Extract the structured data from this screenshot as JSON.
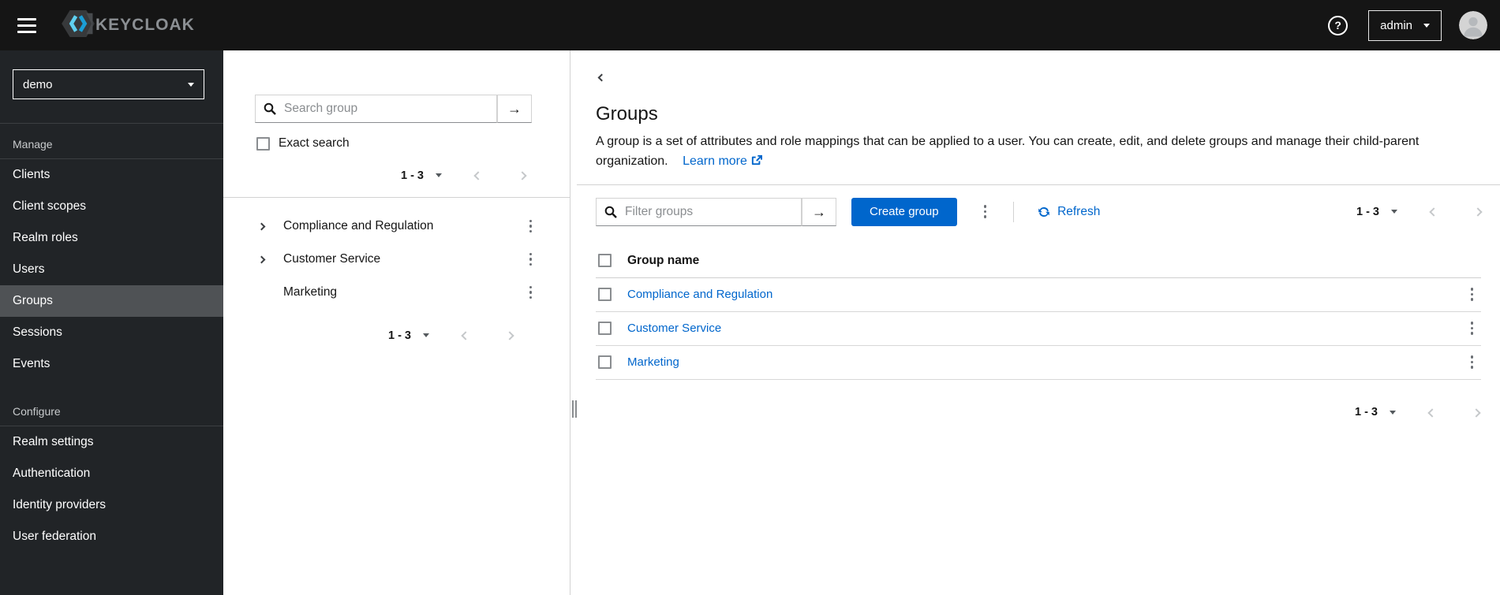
{
  "header": {
    "brand": "KEYCLOAK",
    "user": "admin",
    "help": "?"
  },
  "sidebar": {
    "realm": "demo",
    "sections": [
      {
        "label": "Manage",
        "items": [
          "Clients",
          "Client scopes",
          "Realm roles",
          "Users",
          "Groups",
          "Sessions",
          "Events"
        ],
        "selected_item": "Groups"
      },
      {
        "label": "Configure",
        "items": [
          "Realm settings",
          "Authentication",
          "Identity providers",
          "User federation"
        ]
      }
    ]
  },
  "tree_panel": {
    "search_placeholder": "Search group",
    "search_submit": "→",
    "exact_search_label": "Exact search",
    "top_pagination": {
      "range": "1 - 3"
    },
    "groups": [
      {
        "name": "Compliance and Regulation",
        "expandable": true
      },
      {
        "name": "Customer Service",
        "expandable": true
      },
      {
        "name": "Marketing",
        "expandable": false
      }
    ],
    "bottom_pagination": {
      "range": "1 - 3"
    }
  },
  "main": {
    "title": "Groups",
    "description": "A group is a set of attributes and role mappings that can be applied to a user. You can create, edit, and delete groups and manage their child-parent organization.",
    "learn_more_label": "Learn more",
    "toolbar": {
      "filter_placeholder": "Filter groups",
      "filter_submit": "→",
      "create_button_label": "Create group",
      "refresh_label": "Refresh",
      "pagination": {
        "range": "1 - 3"
      }
    },
    "table": {
      "columns": [
        "Group name"
      ],
      "rows": [
        "Compliance and Regulation",
        "Customer Service",
        "Marketing"
      ]
    },
    "bottom_pagination": {
      "range": "1 - 3"
    }
  },
  "colors": {
    "accent_blue": "#0066cc",
    "link_blue": "#0066cc",
    "masthead_bg": "#151515",
    "sidebar_bg": "#212427",
    "sidebar_selected_bg": "#4f5255",
    "logo_chevron_light": "#5fd0f0",
    "logo_chevron_dark": "#1b9ed6"
  }
}
